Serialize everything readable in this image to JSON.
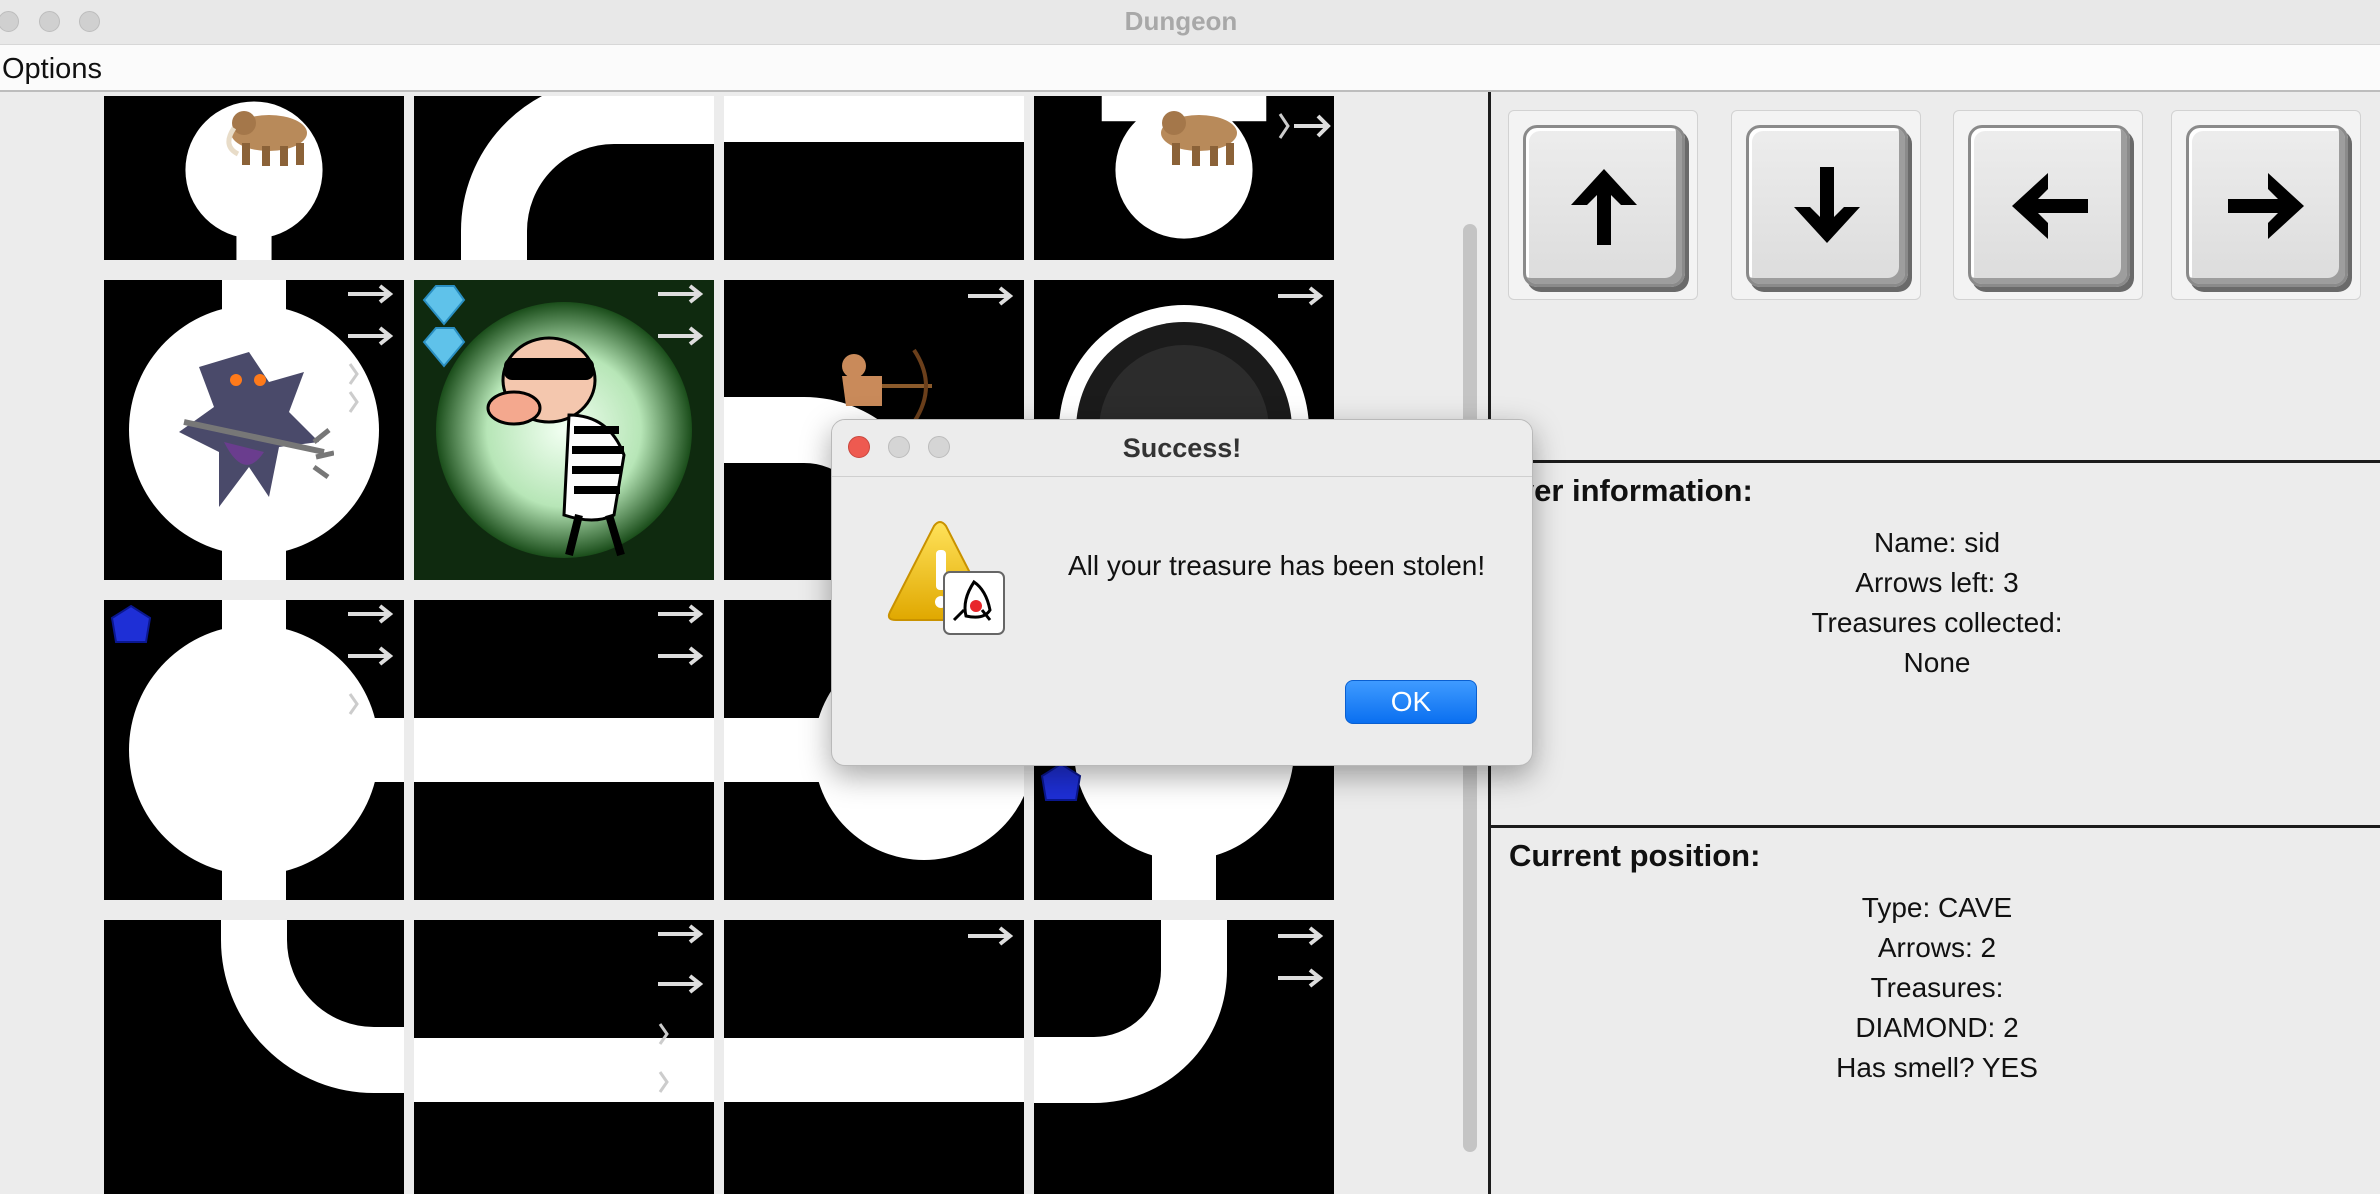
{
  "window": {
    "title": "Dungeon"
  },
  "menu": {
    "options_label": "Options"
  },
  "controls": [
    {
      "name": "move-up-button",
      "icon": "arrow-up-icon"
    },
    {
      "name": "move-down-button",
      "icon": "arrow-down-icon"
    },
    {
      "name": "move-left-button",
      "icon": "arrow-left-icon"
    },
    {
      "name": "move-right-button",
      "icon": "arrow-right-icon"
    }
  ],
  "player_panel": {
    "title": "layer information:",
    "name_line": "Name: sid",
    "arrows_line": "Arrows left: 3",
    "treasures_label": "Treasures collected:",
    "treasures_value": "None"
  },
  "position_panel": {
    "title": "Current position:",
    "type_line": "Type: CAVE",
    "arrows_line": "Arrows: 2",
    "treasures_label": "Treasures:",
    "treasure_item": "DIAMOND: 2",
    "smell_line": "Has smell? YES"
  },
  "dialog": {
    "title": "Success!",
    "message": "All your treasure has been stolen!",
    "ok_label": "OK"
  },
  "colors": {
    "accent": "#0a6ff0",
    "close_red": "#ee5a50",
    "sapphire": "#1e2fd6",
    "diamond": "#5fc2ea"
  }
}
